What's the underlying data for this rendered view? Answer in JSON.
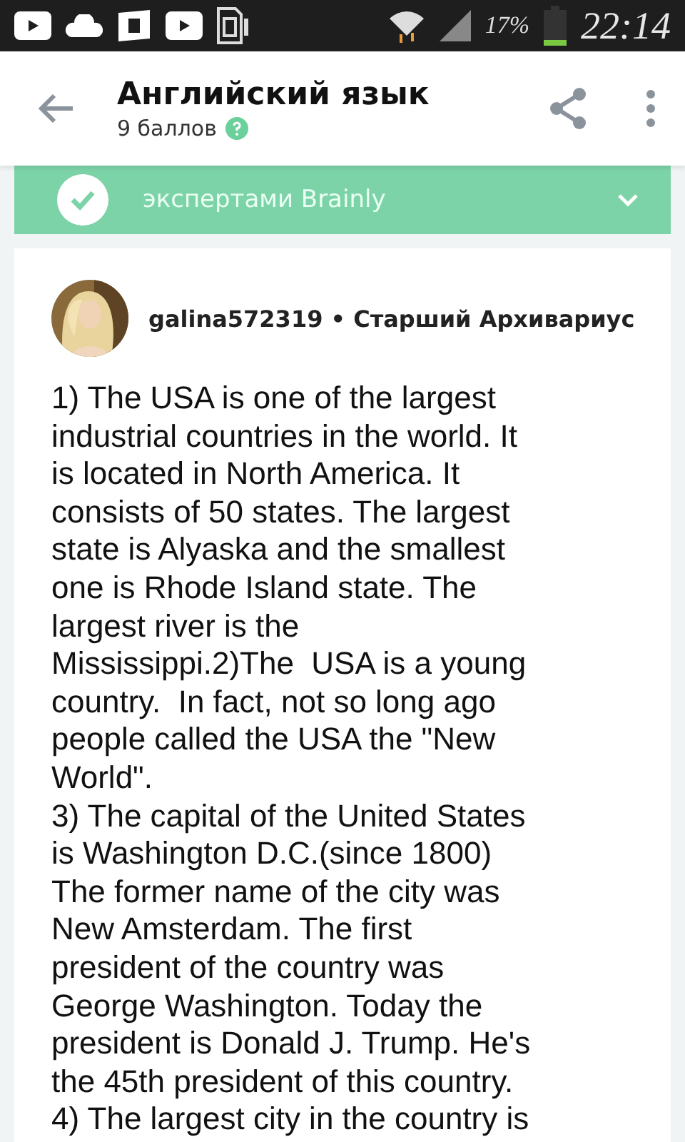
{
  "status_bar": {
    "battery": "17%",
    "time": "22:14"
  },
  "header": {
    "title": "Английский язык",
    "points": "9 баллов"
  },
  "banner": {
    "text": "экспертами Brainly"
  },
  "answer": {
    "author": "galina572319",
    "rank": "Старший Архивариус",
    "separator": "•",
    "lines": [
      "1) The USA is one of the largest",
      "industrial countries in the world. It",
      "is located in North America. It",
      "consists of 50 states. The largest",
      "state is Alyaska and the smallest",
      "one is Rhode Island state. The",
      "largest river is the",
      "Mississippi.2)The  USA is a young",
      "country.  In fact, not so long ago",
      "people called the USA the \"New",
      "World\".",
      "3) The capital of the United States",
      "is Washington D.C.(since 1800)",
      "The former name of the city was",
      "New Amsterdam. The first",
      "president of the country was",
      "George Washington. Today the",
      "president is Donald J. Trump. He's",
      "the 45th president of this country.",
      "4) The largest city in the country is"
    ]
  }
}
